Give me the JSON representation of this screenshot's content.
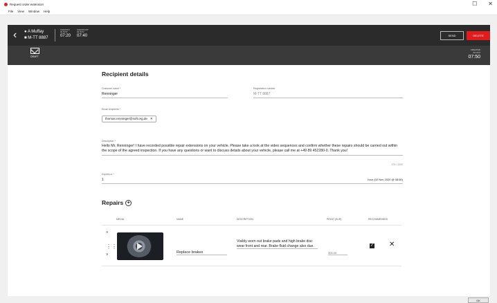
{
  "window": {
    "title": "Request order extension",
    "minimize": "☐",
    "close": "✕"
  },
  "menu": [
    "File",
    "View",
    "Window",
    "Help"
  ],
  "header": {
    "back_icon": "chevron-left-icon",
    "vehicle_name": "A Muffay",
    "vehicle_plate": "M-TT 8887",
    "checkin": {
      "label": "CHECKIN",
      "date": "02 NOV",
      "time": "07:20"
    },
    "checkout": {
      "label": "CHECKOUT",
      "date": "02 NOV",
      "time": "07:40"
    },
    "send_label": "SEND",
    "delete_label": "DELETE"
  },
  "status": {
    "draft_label": "DRAFT",
    "draft_icon": "envelope-icon",
    "created_label": "CREATED",
    "created_date": "02 NOV",
    "created_time": "07:50"
  },
  "recipient": {
    "title": "Recipient details",
    "customer_label": "Customer name *",
    "customer_value": "Renninger",
    "registration_label": "Registration number",
    "registration_value": "M-TT 8887",
    "email_label": "Email recipients *",
    "email_chip": "thomas.renninger@soft.org.de",
    "description_label": "Description *",
    "description_value": "Hello Mr. Renninger! I have recorded possible repair extensions on your vehicle. Please take a look at the video sequences and confirm whether these repairs should be carried out within the scope of the agreed inspection. If you have any questions or want to discuss details about your vehicle, please call me at +49 89 452280-0. Thank you!",
    "description_counter": "375 / 1000",
    "expires_label": "Expires in *",
    "expires_value": "1",
    "expires_note": "hour (02 Nov 2020 @ 08:50)"
  },
  "repairs": {
    "title": "Repairs",
    "add_icon": "plus-circle-icon",
    "columns": [
      "MEDIA",
      "NAME",
      "DESCRIPTION",
      "PRICE (EUR)",
      "RECOMMENDED"
    ],
    "rows": [
      {
        "name": "Replace brakes",
        "description": "Visibly worn out brake pads and high brake disc wear front and rear. Brake fluid change also due.",
        "price": "300.00",
        "recommended": true
      }
    ]
  },
  "footer": {
    "button": "OK"
  },
  "colors": {
    "accent": "#e21c1c",
    "header_bg": "#2b2b2b",
    "subheader_bg": "#3a3a3a"
  }
}
